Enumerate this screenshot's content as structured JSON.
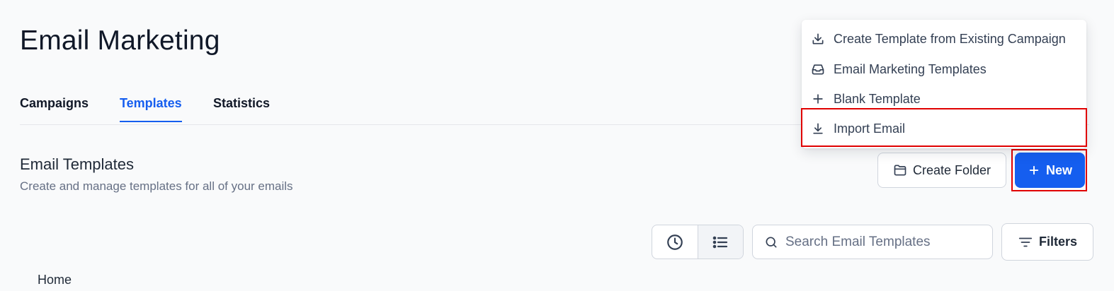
{
  "page": {
    "title": "Email Marketing"
  },
  "tabs": [
    {
      "label": "Campaigns",
      "active": false
    },
    {
      "label": "Templates",
      "active": true
    },
    {
      "label": "Statistics",
      "active": false
    }
  ],
  "section": {
    "title": "Email Templates",
    "subtitle": "Create and manage templates for all of your emails"
  },
  "actions": {
    "create_folder_label": "Create Folder",
    "new_label": "New"
  },
  "menu": {
    "items": [
      {
        "label": "Create Template from Existing Campaign",
        "icon": "download-tray-icon"
      },
      {
        "label": "Email Marketing Templates",
        "icon": "inbox-icon"
      },
      {
        "label": "Blank Template",
        "icon": "plus-icon"
      },
      {
        "label": "Import Email",
        "icon": "download-icon",
        "highlighted": true
      }
    ]
  },
  "toolbar": {
    "view_toggles": [
      {
        "icon": "clock-icon",
        "active": false
      },
      {
        "icon": "list-icon",
        "active": true
      }
    ],
    "search_placeholder": "Search Email Templates",
    "search_value": "",
    "filters_label": "Filters"
  },
  "breadcrumb": {
    "label": "Home"
  },
  "colors": {
    "accent": "#155eef",
    "highlight": "#e00000",
    "background": "#f9fafb"
  }
}
